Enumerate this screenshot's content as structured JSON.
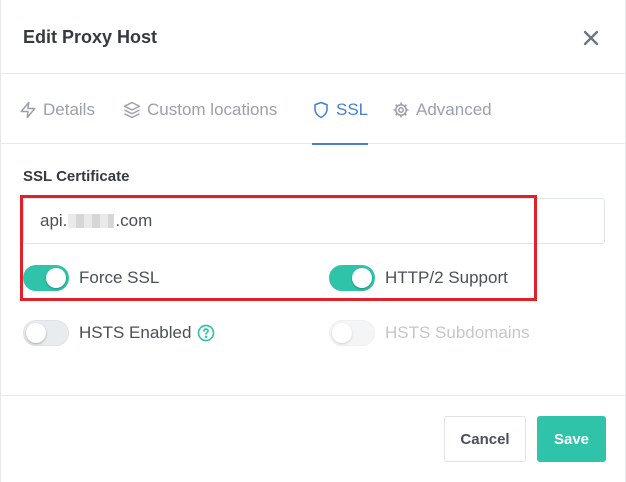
{
  "modal": {
    "title": "Edit Proxy Host",
    "close_icon": "close-icon"
  },
  "tabs": [
    {
      "label": "Details",
      "icon": "bolt-icon",
      "active": false
    },
    {
      "label": "Custom locations",
      "icon": "layers-icon",
      "active": false
    },
    {
      "label": "SSL",
      "icon": "shield-icon",
      "active": true
    },
    {
      "label": "Advanced",
      "icon": "gear-icon",
      "active": false
    }
  ],
  "ssl": {
    "section_label": "SSL Certificate",
    "certificate": {
      "prefix": "api.",
      "suffix": ".com"
    },
    "toggles": {
      "force_ssl": {
        "label": "Force SSL",
        "on": true,
        "disabled": false
      },
      "http2": {
        "label": "HTTP/2 Support",
        "on": true,
        "disabled": false
      },
      "hsts": {
        "label": "HSTS Enabled",
        "on": false,
        "disabled": false,
        "help_icon": "question-circle-icon"
      },
      "hsts_subdomains": {
        "label": "HSTS Subdomains",
        "on": false,
        "disabled": true
      }
    }
  },
  "footer": {
    "cancel_label": "Cancel",
    "save_label": "Save"
  },
  "colors": {
    "accent": "#2fc4a9",
    "active_tab": "#467fcf",
    "highlight": "#e2202a"
  }
}
